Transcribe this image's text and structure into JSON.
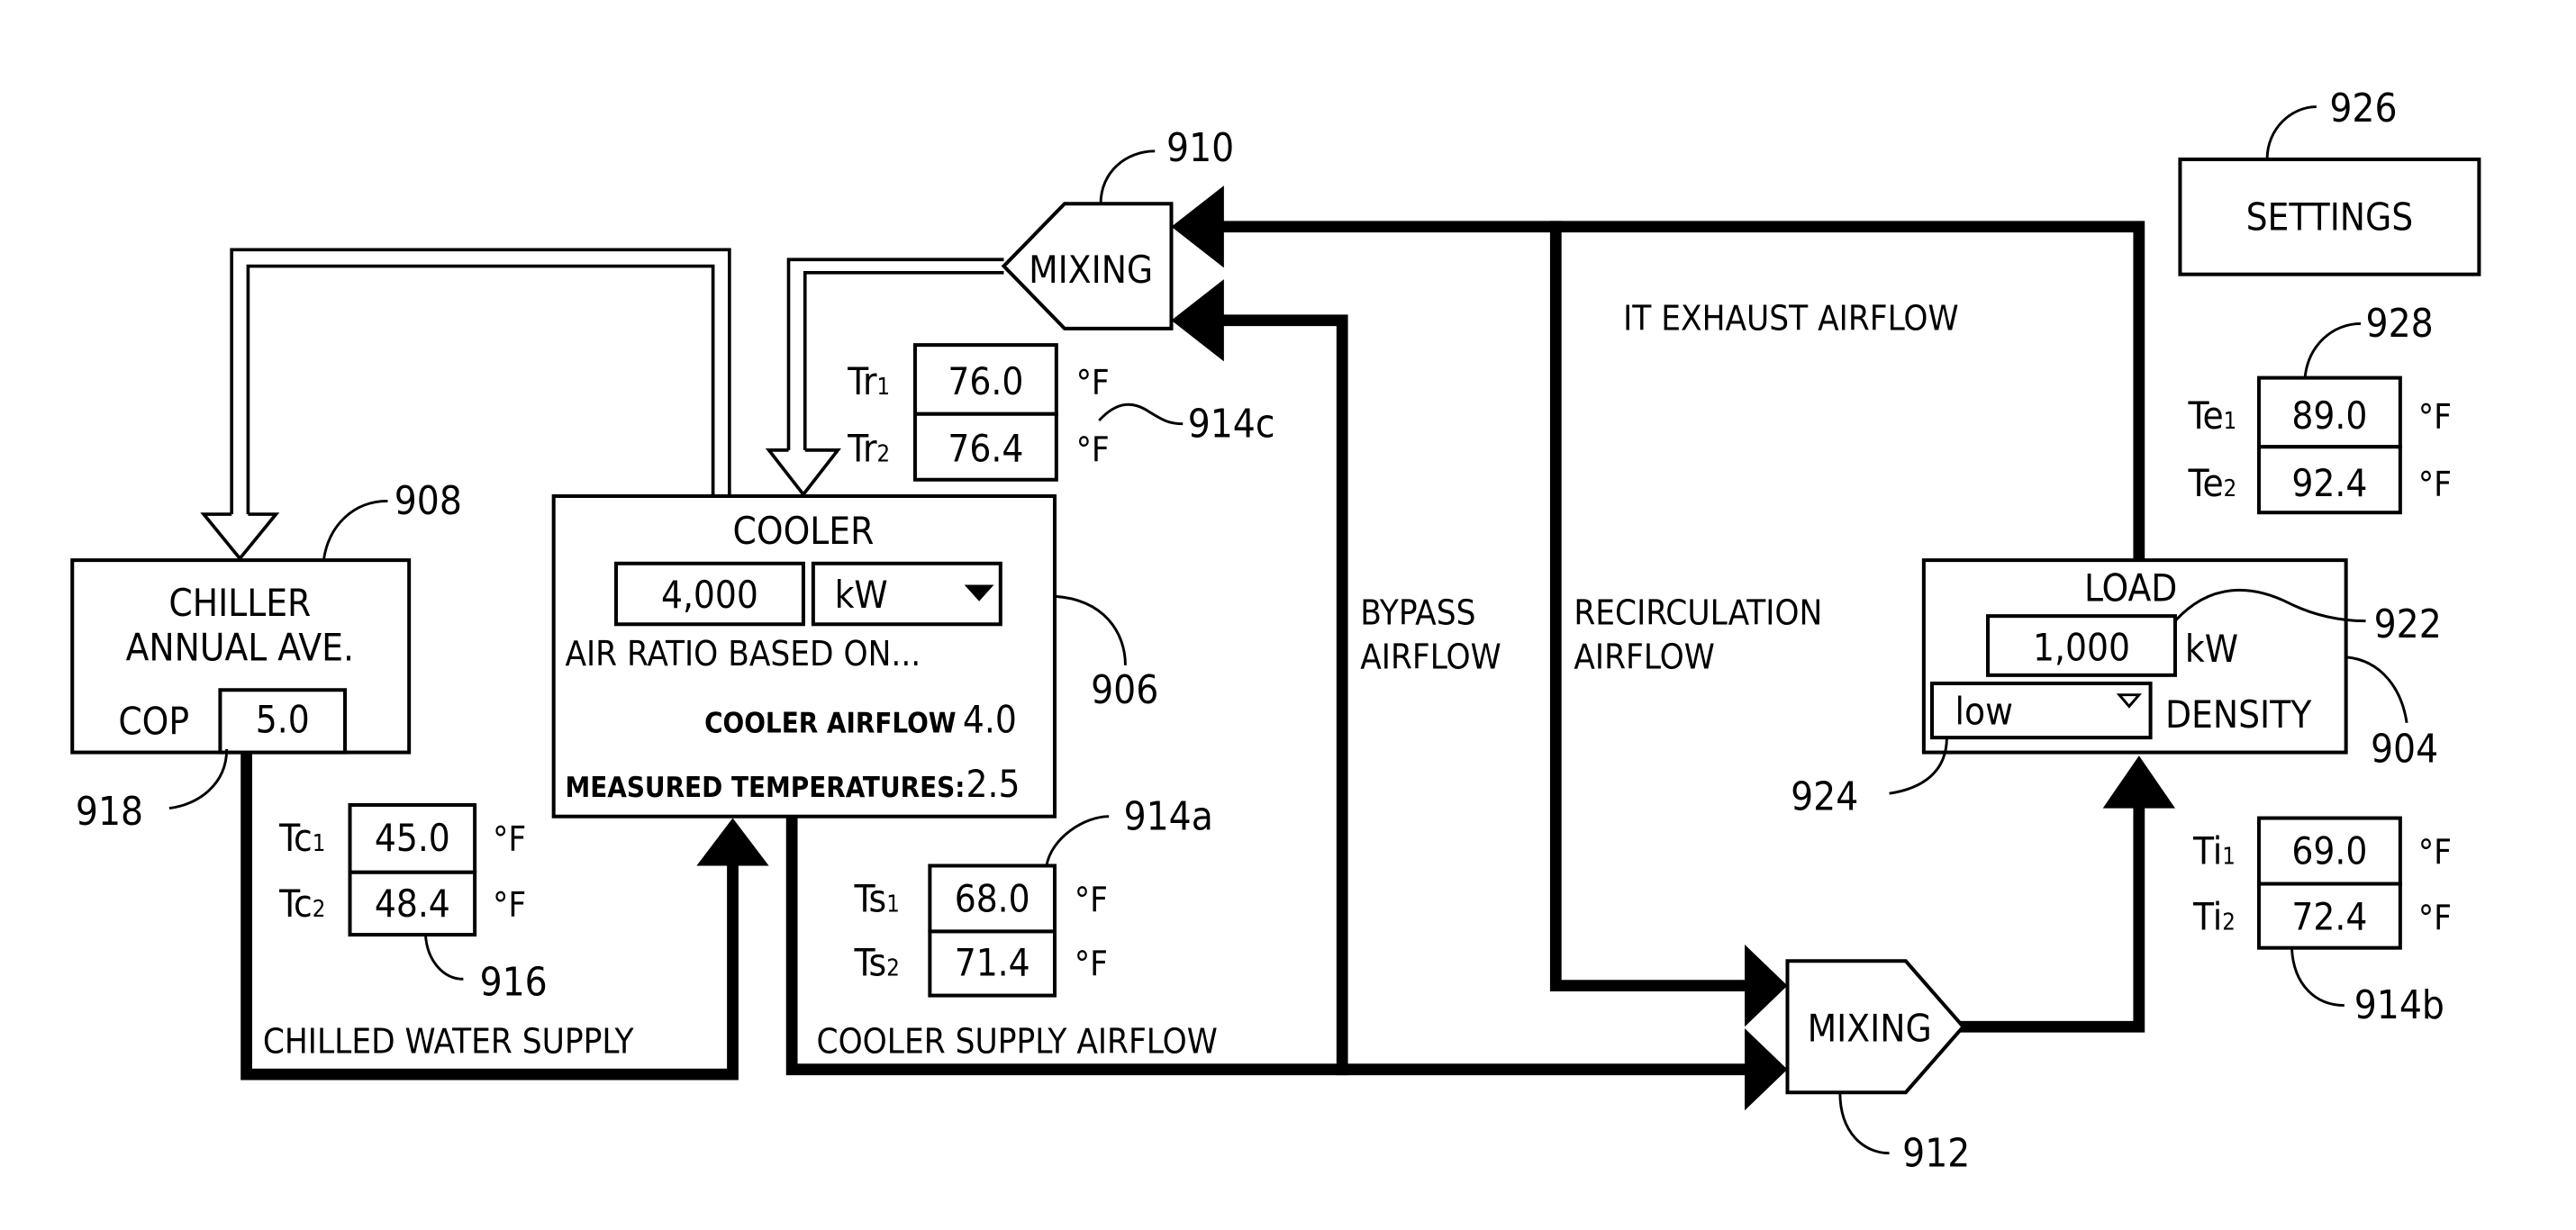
{
  "figure": {
    "settings": {
      "label": "SETTINGS",
      "ref": "926"
    },
    "chiller": {
      "title_line1": "CHILLER",
      "title_line2": "ANNUAL AVE.",
      "cop_label": "COP",
      "cop_value": "5.0",
      "ref": "908",
      "cop_ref": "918"
    },
    "cooler": {
      "title": "COOLER",
      "capacity_value": "4,000",
      "capacity_unit": "kW",
      "air_ratio_label": "AIR RATIO BASED ON...",
      "cooler_airflow_label": "COOLER AIRFLOW",
      "cooler_airflow_value": "4.0",
      "measured_temps_label": "MEASURED TEMPERATURES:",
      "measured_temps_value": "2.5",
      "ref": "906"
    },
    "mixing_top": {
      "label": "MIXING",
      "ref": "910"
    },
    "mixing_bottom": {
      "label": "MIXING",
      "ref": "912"
    },
    "load": {
      "title": "LOAD",
      "power_value": "1,000",
      "power_unit": "kW",
      "density_value": "low",
      "density_label": "DENSITY",
      "ref": "904",
      "power_ref": "922",
      "density_ref": "924"
    },
    "flows": {
      "it_exhaust": "IT EXHAUST AIRFLOW",
      "bypass_line1": "BYPASS",
      "bypass_line2": "AIRFLOW",
      "recirc_line1": "RECIRCULATION",
      "recirc_line2": "AIRFLOW",
      "chilled_water": "CHILLED WATER SUPPLY",
      "cooler_supply": "COOLER SUPPLY AIRFLOW"
    },
    "sensors": {
      "return": {
        "ref": "914c",
        "rows": [
          {
            "name": "Tr",
            "idx": "1",
            "value": "76.0",
            "unit": "°F"
          },
          {
            "name": "Tr",
            "idx": "2",
            "value": "76.4",
            "unit": "°F"
          }
        ]
      },
      "exhaust": {
        "ref": "928",
        "rows": [
          {
            "name": "Te",
            "idx": "1",
            "value": "89.0",
            "unit": "°F"
          },
          {
            "name": "Te",
            "idx": "2",
            "value": "92.4",
            "unit": "°F"
          }
        ]
      },
      "chilled": {
        "ref": "916",
        "rows": [
          {
            "name": "Tc",
            "idx": "1",
            "value": "45.0",
            "unit": "°F"
          },
          {
            "name": "Tc",
            "idx": "2",
            "value": "48.4",
            "unit": "°F"
          }
        ]
      },
      "supply": {
        "ref": "914a",
        "rows": [
          {
            "name": "Ts",
            "idx": "1",
            "value": "68.0",
            "unit": "°F"
          },
          {
            "name": "Ts",
            "idx": "2",
            "value": "71.4",
            "unit": "°F"
          }
        ]
      },
      "inlet": {
        "ref": "914b",
        "rows": [
          {
            "name": "Ti",
            "idx": "1",
            "value": "69.0",
            "unit": "°F"
          },
          {
            "name": "Ti",
            "idx": "2",
            "value": "72.4",
            "unit": "°F"
          }
        ]
      }
    }
  }
}
